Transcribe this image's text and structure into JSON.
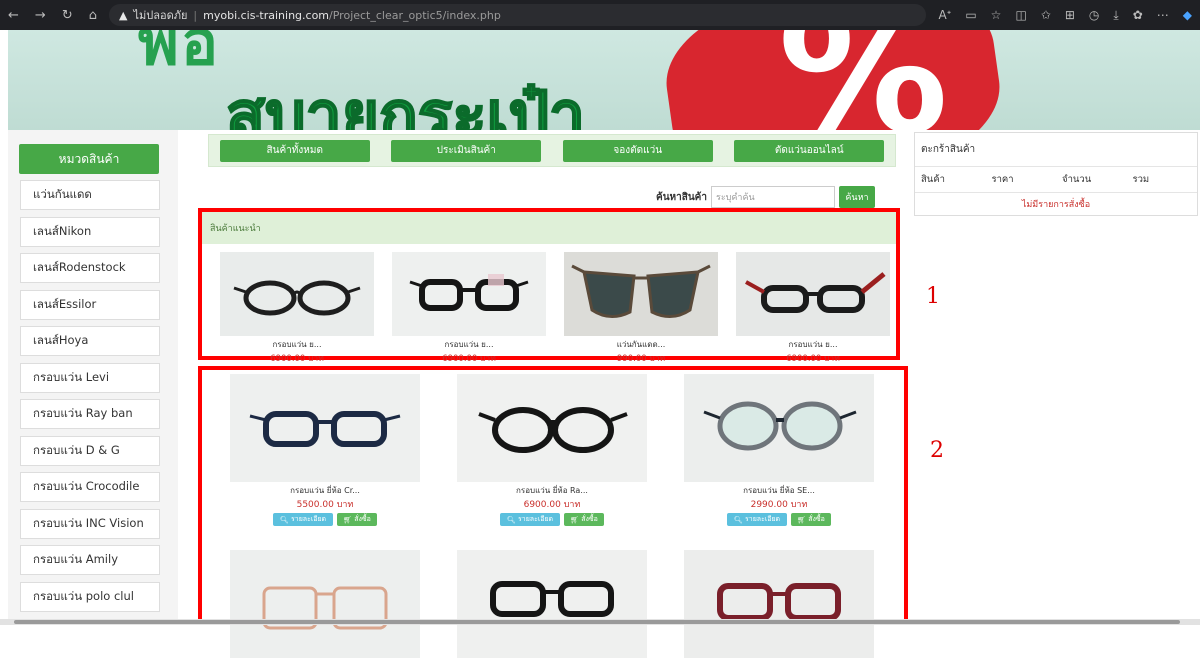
{
  "browser": {
    "security_label": "ไม่ปลอดภัย",
    "url_host": "myobi.cis-training.com",
    "url_path": "/Project_clear_optic5/index.php"
  },
  "banner": {
    "headline": "สบายกระเป๋า",
    "accent_color": "#d8262f",
    "brand_color": "#159a40"
  },
  "sidebar": {
    "header": "หมวดสินค้า",
    "items": [
      "แว่นกันแดด",
      "เลนส์Nikon",
      "เลนส์Rodenstock",
      "เลนส์Essilor",
      "เลนส์Hoya",
      "กรอบแว่น Levi",
      "กรอบแว่น Ray ban",
      "กรอบแว่น D & G",
      "กรอบแว่น Crocodile",
      "กรอบแว่น INC Vision",
      "กรอบแว่น Amily",
      "กรอบแว่น polo clul"
    ]
  },
  "tabs": [
    "สินค้าทั้งหมด",
    "ประเมินสินค้า",
    "จองตัดแว่น",
    "ตัดแว่นออนไลน์"
  ],
  "search": {
    "label": "ค้นหาสินค้า",
    "placeholder": "ระบุคำค้น",
    "button": "ค้นหา"
  },
  "recommended": {
    "header": "สินค้าแนะนำ",
    "items": [
      {
        "name": "กรอบแว่น ย...",
        "price": "6900.00 บาท"
      },
      {
        "name": "กรอบแว่น ย...",
        "price": "6900.00 บาท"
      },
      {
        "name": "แว่นกันแดด...",
        "price": "990.00 บาท"
      },
      {
        "name": "กรอบแว่น ย...",
        "price": "6900.00 บาท"
      }
    ]
  },
  "products": {
    "detail_label": "รายละเอียด",
    "order_label": "สั่งซื้อ",
    "items": [
      {
        "name": "กรอบแว่น ยี่ห้อ Cr...",
        "price": "5500.00 บาท"
      },
      {
        "name": "กรอบแว่น ยี่ห้อ Ra...",
        "price": "6900.00 บาท"
      },
      {
        "name": "กรอบแว่น ยี่ห้อ SE...",
        "price": "2990.00 บาท"
      }
    ]
  },
  "cart": {
    "title": "ตะกร้าสินค้า",
    "columns": [
      "สินค้า",
      "ราคา",
      "จำนวน",
      "รวม"
    ],
    "empty_text": "ไม่มีรายการสั่งซื้อ"
  },
  "annotations": [
    "1",
    "2"
  ]
}
